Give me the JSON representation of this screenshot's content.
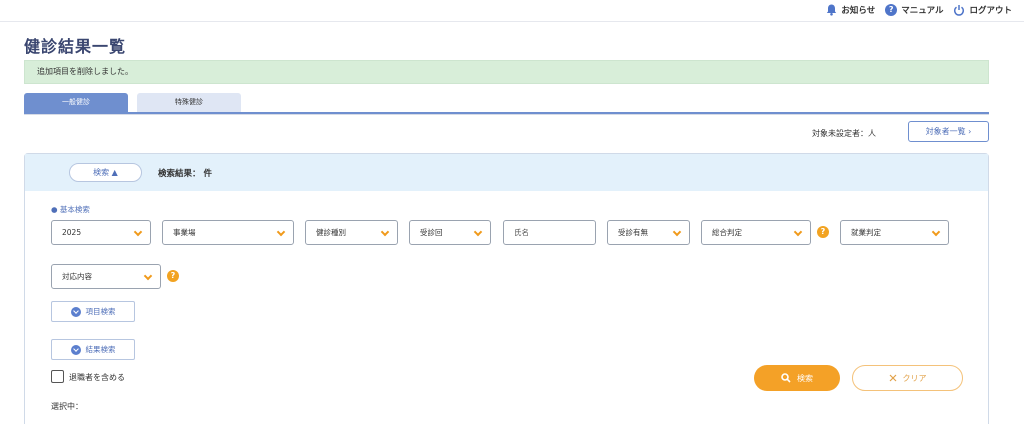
{
  "topnav": {
    "notice": "お知らせ",
    "manual": "マニュアル",
    "logout": "ログアウト"
  },
  "page": {
    "title": "健診結果一覧",
    "alert": "追加項目を削除しました。"
  },
  "tabs": [
    {
      "label": "一般健診",
      "active": true
    },
    {
      "label": "特殊健診",
      "active": false
    }
  ],
  "targets": {
    "unset_label": "対象未設定者：人",
    "list_button": "対象者一覧 ›"
  },
  "search_panel": {
    "toggle_label": "検索 ▲",
    "result_label": "検索結果：  件",
    "section_label": "● 基本検索",
    "fields": {
      "year": "2025",
      "workplace": "事業場",
      "exam_type": "健診種別",
      "exam_round": "受診回",
      "name_placeholder": "氏名",
      "exam_status": "受診有無",
      "overall_judgment": "総合判定",
      "work_judgment": "就業判定",
      "response": "対応内容"
    },
    "item_search": "項目検索",
    "result_search": "結果検索",
    "include_retired": "退職者を含める",
    "selected": "選択中：",
    "search_button": "検索",
    "clear_button": "クリア"
  },
  "colors": {
    "accent": "#6f8fcf",
    "orange": "#f4a127",
    "alert_bg": "#d8eed9",
    "panel_head": "#e3f1fb"
  },
  "icons": [
    "bell-icon",
    "help-icon",
    "power-icon",
    "chevron-down-icon",
    "search-icon",
    "close-icon"
  ]
}
